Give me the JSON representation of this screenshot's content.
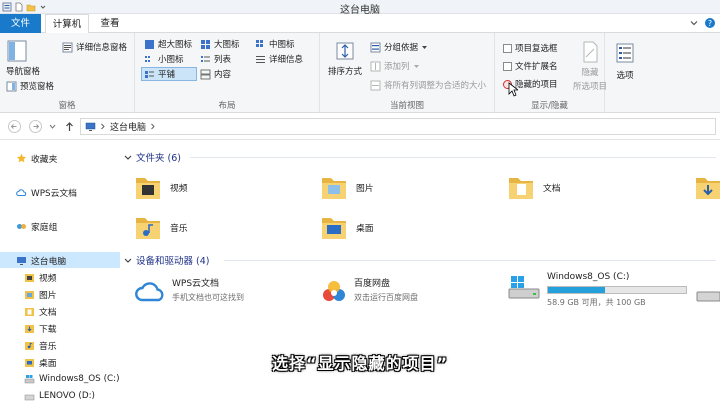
{
  "window": {
    "title": "这台电脑"
  },
  "tabs": {
    "file": "文件",
    "computer": "计算机",
    "view": "查看"
  },
  "ribbon": {
    "panes": {
      "nav_pane_label": "导航窗格",
      "preview_pane": "预览窗格",
      "details_pane": "详细信息窗格",
      "group_label": "窗格"
    },
    "layout": {
      "extra_large_icons": "超大图标",
      "large_icons": "大图标",
      "medium_icons": "中图标",
      "small_icons": "小图标",
      "list": "列表",
      "details": "详细信息",
      "tiles": "平铺",
      "content": "内容",
      "group_label": "布局"
    },
    "current_view": {
      "sort_by": "排序方式",
      "group_by": "分组依据",
      "add_columns": "添加列",
      "size_all_columns": "将所有列调整为合适的大小",
      "group_label": "当前视图"
    },
    "show_hide": {
      "item_checkboxes": "项目复选框",
      "file_name_extensions": "文件扩展名",
      "hidden_items": "隐藏的项目",
      "hide_selected": "隐藏",
      "hide_selected_sub": "所选项目",
      "group_label": "显示/隐藏"
    },
    "options": "选项"
  },
  "address": {
    "path": "这台电脑"
  },
  "nav": {
    "favorites": "收藏夹",
    "wps_cloud": "WPS云文档",
    "homegroup": "家庭组",
    "this_pc": "这台电脑",
    "videos": "视频",
    "pictures": "图片",
    "documents": "文档",
    "downloads": "下载",
    "music": "音乐",
    "desktop": "桌面",
    "drive_c": "Windows8_OS (C:)",
    "drive_d": "LENOVO (D:)"
  },
  "folders_section": {
    "title": "文件夹 (6)",
    "items": [
      "视频",
      "图片",
      "文档",
      "音乐",
      "桌面"
    ]
  },
  "devices_section": {
    "title": "设备和驱动器 (4)",
    "wps": {
      "name": "WPS云文档",
      "sub": "手机文档也可这找到"
    },
    "baidu": {
      "name": "百度网盘",
      "sub": "双击运行百度网盘"
    },
    "drive_c": {
      "name": "Windows8_OS (C:)",
      "free": "58.9 GB 可用，共 100 GB",
      "used_fraction": 0.41
    }
  },
  "caption": "选择“显示隐藏的项目”",
  "colors": {
    "accent": "#1979ca",
    "selection": "#cce8ff",
    "section_heading": "#1e3287",
    "drive_fill": "#26a0da"
  }
}
